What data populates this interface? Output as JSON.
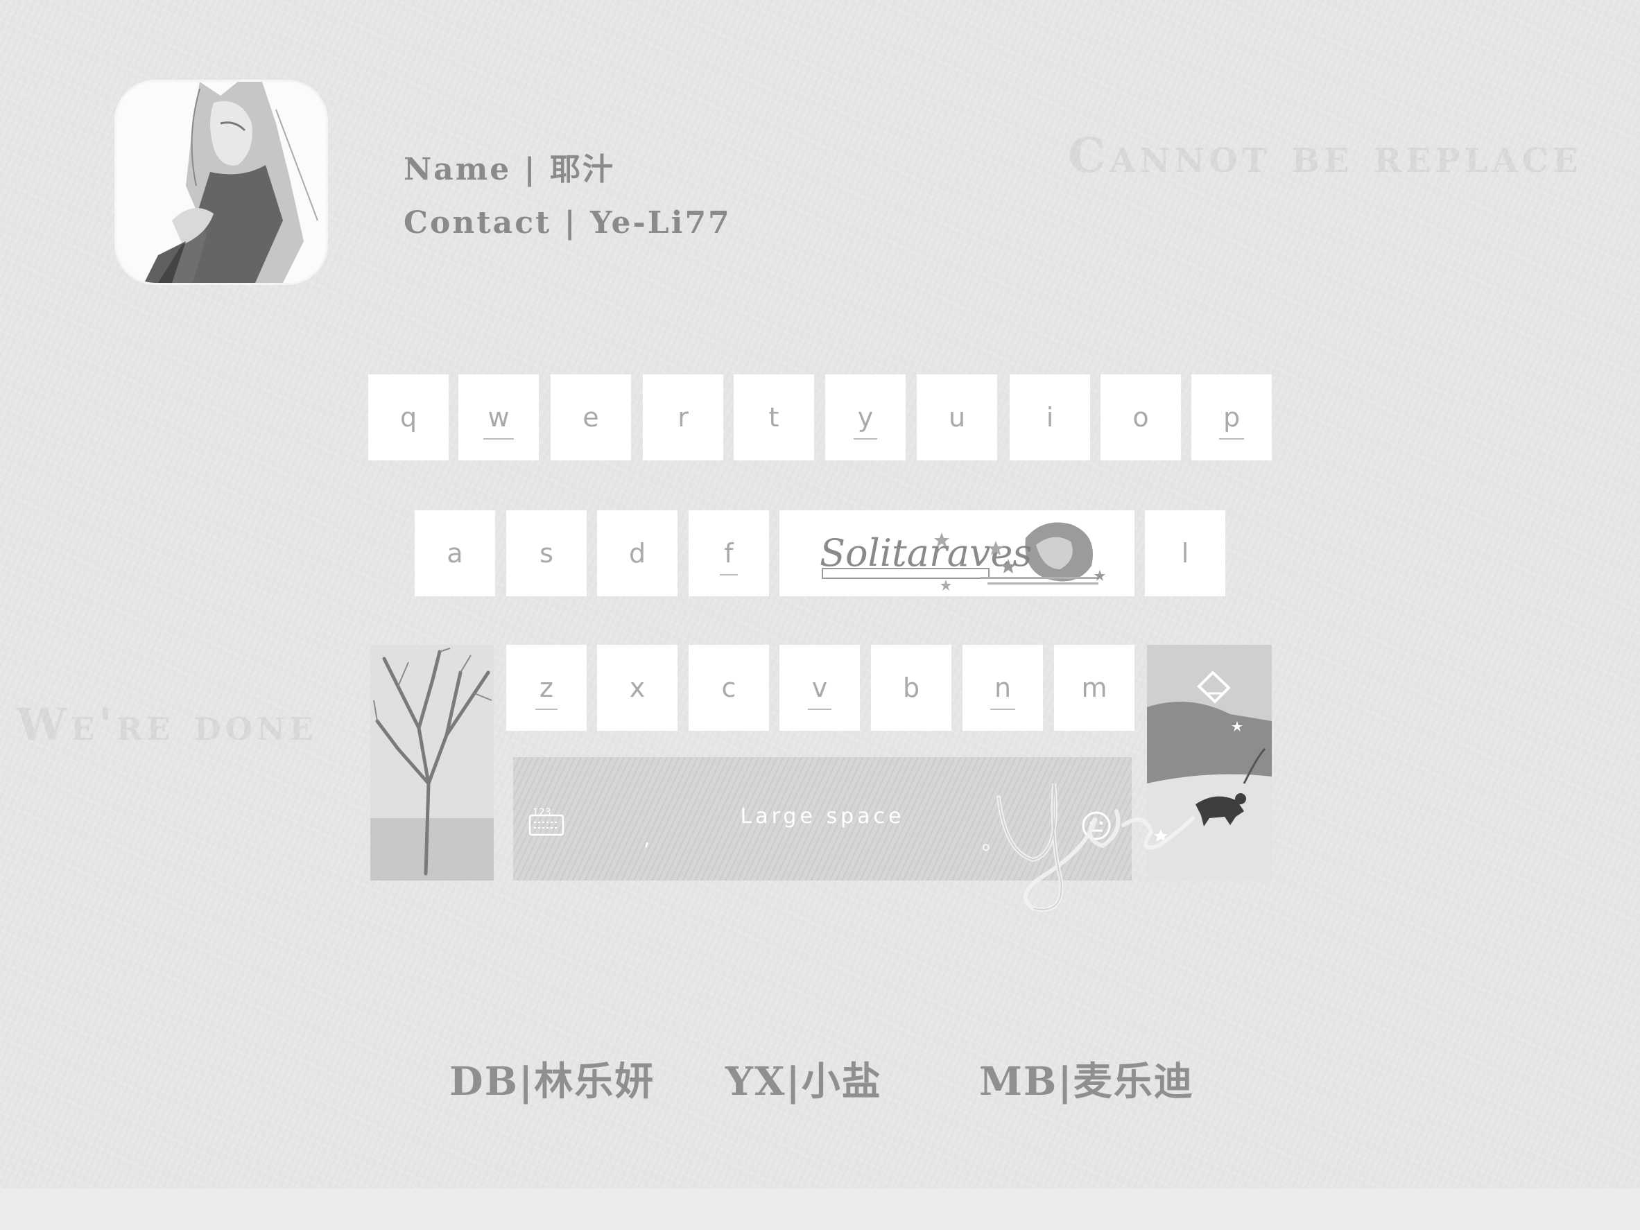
{
  "profile": {
    "name_line": "Name | 耶汁",
    "contact_line": "Contact | Ye-Li77"
  },
  "watermarks": {
    "top": "Cannot be replace",
    "left": "We're done"
  },
  "keyboard": {
    "row1": [
      {
        "label": "q",
        "underline": false
      },
      {
        "label": "w",
        "underline": true
      },
      {
        "label": "e",
        "underline": false
      },
      {
        "label": "r",
        "underline": false
      },
      {
        "label": "t",
        "underline": false
      },
      {
        "label": "y",
        "underline": true
      },
      {
        "label": "u",
        "underline": false
      },
      {
        "label": "i",
        "underline": false
      },
      {
        "label": "o",
        "underline": false
      },
      {
        "label": "p",
        "underline": true
      }
    ],
    "row2": [
      {
        "label": "a",
        "underline": false
      },
      {
        "label": "s",
        "underline": false
      },
      {
        "label": "d",
        "underline": false
      },
      {
        "label": "f",
        "underline": true
      }
    ],
    "row2_end": {
      "label": "l",
      "underline": false
    },
    "row3": [
      {
        "label": "z",
        "underline": true
      },
      {
        "label": "x",
        "underline": false
      },
      {
        "label": "c",
        "underline": false
      },
      {
        "label": "v",
        "underline": true
      },
      {
        "label": "b",
        "underline": false
      },
      {
        "label": "n",
        "underline": true
      },
      {
        "label": "m",
        "underline": false
      }
    ],
    "banner_text": "Solitaraves",
    "space_label": "Large space",
    "comma": ",",
    "period": "。",
    "numbers_icon": "keyboard-123-icon",
    "emoji_icon": "emoji-face-icon"
  },
  "credits": [
    {
      "text": "DB|林乐妍"
    },
    {
      "text": "YX|小盐"
    },
    {
      "text": "MB|麦乐迪"
    }
  ]
}
